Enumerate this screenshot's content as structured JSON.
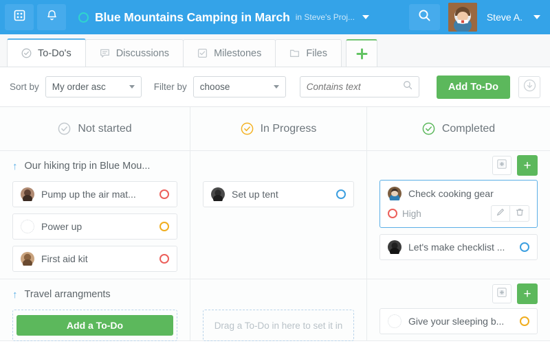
{
  "header": {
    "apps_icon": "grid-icon",
    "bell_icon": "bell-icon",
    "project_icon": "ring-icon",
    "title": "Blue Mountains Camping in March",
    "subtitle": "in Steve's Proj...",
    "search_icon": "search-icon",
    "user_name": "Steve A.",
    "avatar": "user-avatar"
  },
  "tabs": [
    {
      "label": "To-Do's",
      "icon": "check-circle-icon",
      "active": true
    },
    {
      "label": "Discussions",
      "icon": "comment-icon",
      "active": false
    },
    {
      "label": "Milestones",
      "icon": "checkbox-icon",
      "active": false
    },
    {
      "label": "Files",
      "icon": "folder-icon",
      "active": false
    }
  ],
  "tab_add_label": "+",
  "toolbar": {
    "sort_label": "Sort by",
    "sort_value": "My order asc",
    "filter_label": "Filter by",
    "filter_value": "choose",
    "search_placeholder": "Contains text",
    "search_value": "",
    "add_todo_label": "Add To-Do",
    "download_icon": "download-circle-icon"
  },
  "columns": [
    {
      "name": "not-started",
      "header": "Not started",
      "header_icon": "check-circle-grey-icon",
      "groups": [
        {
          "title": "Our hiking trip in Blue Mou...",
          "cards": [
            {
              "title": "Pump up the air mat...",
              "status": "red",
              "avatar": "photo"
            },
            {
              "title": "Power up",
              "status": "orange",
              "avatar": "placeholder"
            },
            {
              "title": "First aid kit",
              "status": "red",
              "avatar": "photo"
            }
          ]
        },
        {
          "title": "Travel arrangments",
          "add_label": "Add a To-Do"
        }
      ]
    },
    {
      "name": "in-progress",
      "header": "In Progress",
      "header_icon": "check-circle-orange-icon",
      "groups": [
        {
          "cards": [
            {
              "title": "Set up tent",
              "status": "blue",
              "avatar": "photo"
            }
          ]
        },
        {
          "dropzone_text": "Drag a To-Do in here to set it in"
        }
      ]
    },
    {
      "name": "completed",
      "header": "Completed",
      "header_icon": "check-circle-green-icon",
      "groups": [
        {
          "box_icon": "add-to-box-icon",
          "plus_label": "+",
          "selected_card": {
            "title": "Check cooking gear",
            "priority": "High",
            "priority_color": "red",
            "edit_icon": "pencil-icon",
            "delete_icon": "trash-icon"
          },
          "cards": [
            {
              "title": "Let's make checklist ...",
              "status": "blue",
              "avatar": "photo"
            }
          ]
        },
        {
          "box_icon": "add-to-box-icon",
          "plus_label": "+",
          "cards": [
            {
              "title": "Give your sleeping b...",
              "status": "orange",
              "avatar": "placeholder"
            }
          ]
        }
      ]
    }
  ],
  "colors": {
    "header_blue": "#34a3e8",
    "green": "#5cb85c",
    "red": "#ec5f5a",
    "orange": "#f0ad1e",
    "blue": "#3c9fe0",
    "teal": "#2fd6cd"
  }
}
